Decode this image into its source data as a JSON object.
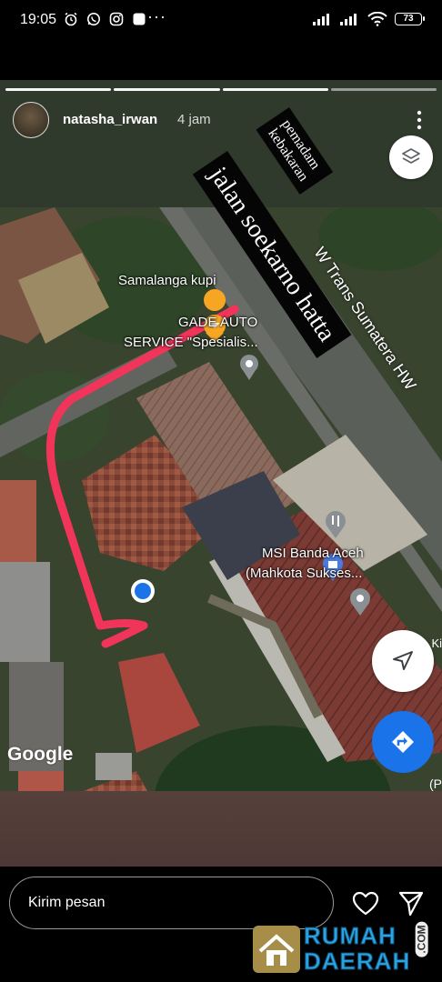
{
  "status_bar": {
    "time": "19:05",
    "battery": "73",
    "more": "···"
  },
  "story": {
    "username": "natasha_irwan",
    "time_ago": "4 jam",
    "progress_segments": 4,
    "progress_done": 3
  },
  "map": {
    "labels": {
      "place_1": "Samalanga kupi",
      "place_2_line1": "GADE AUTO",
      "place_2_line2": "SERVICE \"Spesialis...",
      "place_3_line1": "MSI Banda Aceh",
      "place_3_line2": "(Mahkota Sukses...",
      "road_name": "W Trans Sumatera HW",
      "edge_ki": "Ki",
      "edge_p": "(P"
    },
    "annotations": {
      "overlay_1_line1": "pemadam",
      "overlay_1_line2": "kebakaran",
      "overlay_2": "jalan soekarno hatta"
    },
    "attribution": "Google",
    "accent_colors": {
      "route_arrow": "#f0345a",
      "pin_blue": "#1a73e8",
      "pin_orange": "#f6a623"
    }
  },
  "reply": {
    "placeholder": "Kirim pesan"
  },
  "watermark": {
    "line1": "RUMAH",
    "line2": "DAERAH",
    "suffix": ".COM"
  }
}
